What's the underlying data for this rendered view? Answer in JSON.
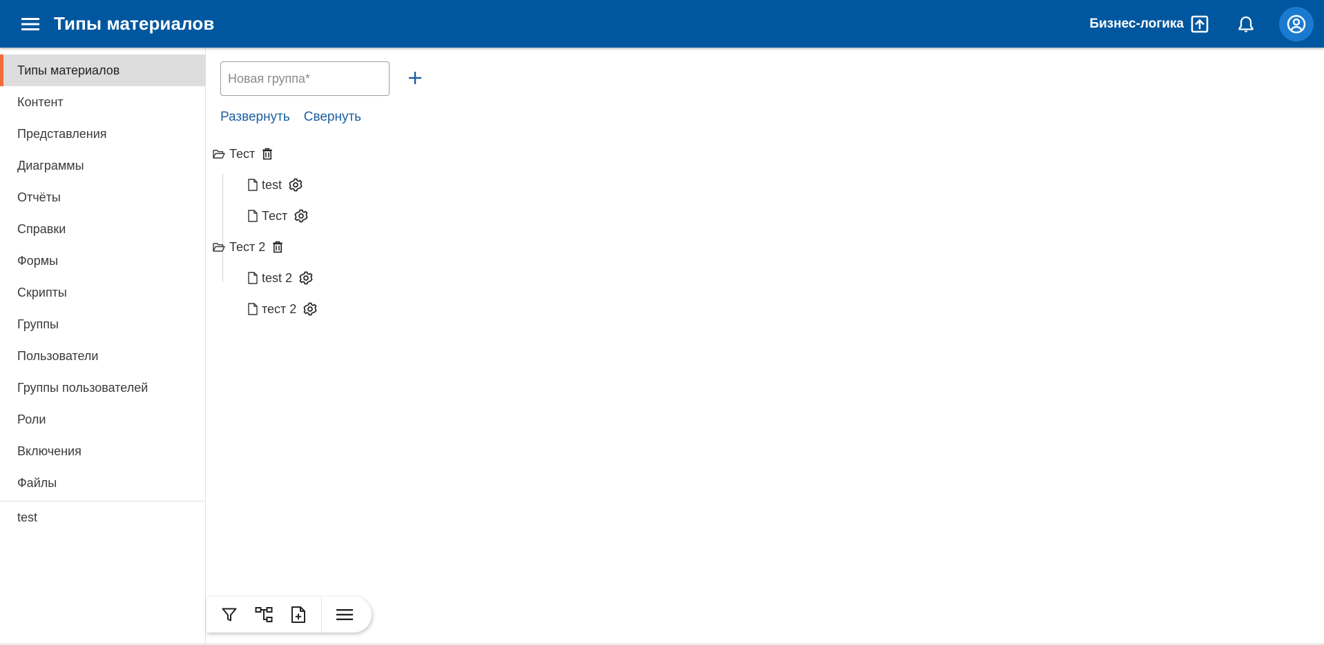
{
  "app": {
    "title": "Типы материалов",
    "business_logic_label": "Бизнес-логика",
    "brand_color": "#00579f",
    "accent_color": "#f26b3a"
  },
  "sidebar": {
    "items": [
      {
        "label": "Типы материалов",
        "active": true
      },
      {
        "label": "Контент"
      },
      {
        "label": "Представления"
      },
      {
        "label": "Диаграммы"
      },
      {
        "label": "Отчёты"
      },
      {
        "label": "Справки"
      },
      {
        "label": "Формы"
      },
      {
        "label": "Скрипты"
      },
      {
        "label": "Группы"
      },
      {
        "label": "Пользователи"
      },
      {
        "label": "Группы пользователей"
      },
      {
        "label": "Роли"
      },
      {
        "label": "Включения"
      },
      {
        "label": "Файлы"
      }
    ],
    "extra_items": [
      {
        "label": "test"
      }
    ]
  },
  "main": {
    "new_group_placeholder": "Новая группа*",
    "new_group_value": "",
    "expand_label": "Развернуть",
    "collapse_label": "Свернуть",
    "tree": [
      {
        "group": "Тест",
        "icon": "folder-open-icon",
        "items": [
          {
            "label": "test",
            "icon": "file-icon"
          },
          {
            "label": "Тест",
            "icon": "file-icon"
          }
        ]
      },
      {
        "group": "Тест 2",
        "icon": "folder-open-icon",
        "items": [
          {
            "label": "test 2",
            "icon": "file-icon"
          },
          {
            "label": "тест 2",
            "icon": "file-icon"
          }
        ]
      }
    ]
  },
  "toolbar": {
    "icons": [
      "filter-icon",
      "tree-icon",
      "add-file-icon",
      "menu-icon"
    ]
  }
}
